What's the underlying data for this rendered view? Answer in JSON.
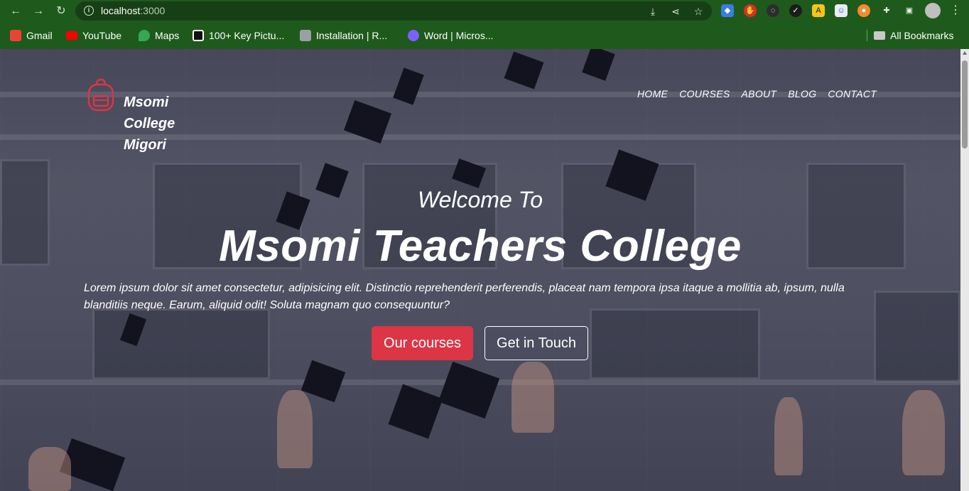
{
  "browser": {
    "url_host": "localhost",
    "url_port": ":3000",
    "bookmarks": [
      {
        "label": "Gmail",
        "icon": "gmail-icon",
        "color": "#ea4335"
      },
      {
        "label": "YouTube",
        "icon": "youtube-icon",
        "color": "#ff0000"
      },
      {
        "label": "Maps",
        "icon": "maps-icon",
        "color": "#34a853"
      },
      {
        "label": "100+ Key Pictu...",
        "icon": "page-icon",
        "color": "#111111"
      },
      {
        "label": "Installation | R...",
        "icon": "page-icon",
        "color": "#9aa0a6"
      },
      {
        "label": "Word | Micros...",
        "icon": "word-icon",
        "color": "#7b61ff"
      }
    ],
    "all_bookmarks": "All Bookmarks"
  },
  "site": {
    "logo_lines": [
      "Msomi",
      "College",
      "Migori"
    ],
    "logo_color": "#dc3545",
    "menu": [
      "HOME",
      "COURSES",
      "ABOUT",
      "BLOG",
      "CONTACT"
    ]
  },
  "hero": {
    "welcome": "Welcome To",
    "title": "Msomi Teachers College",
    "description": "Lorem ipsum dolor sit amet consectetur, adipisicing elit. Distinctio reprehenderit perferendis, placeat nam tempora ipsa itaque a mollitia ab, ipsum, nulla blanditiis neque. Earum, aliquid odit! Soluta magnam quo consequuntur?",
    "primary_button": "Our courses",
    "secondary_button": "Get in Touch",
    "accent": "#dc3545"
  }
}
